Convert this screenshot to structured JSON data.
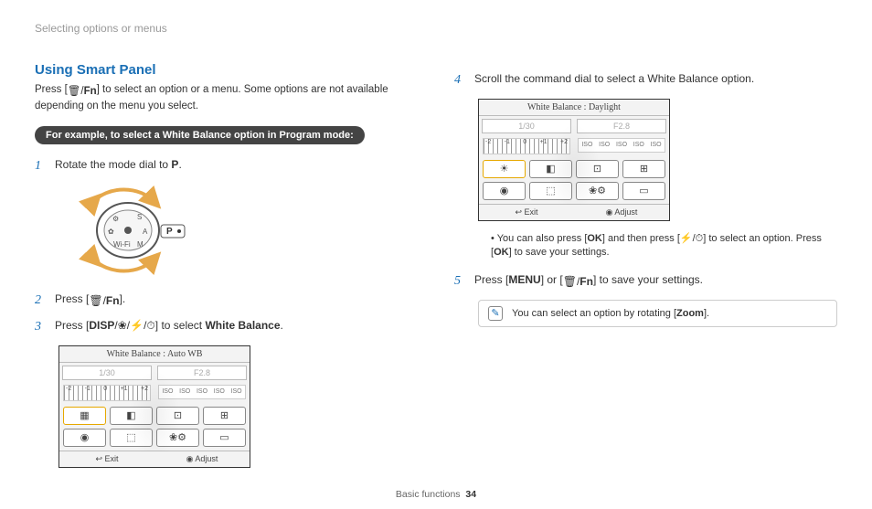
{
  "breadcrumb": "Selecting options or menus",
  "title": "Using Smart Panel",
  "intro_a": "Press [",
  "intro_b": "] to select an option or a menu. Some options are not available depending on the menu you select.",
  "pill": "For example, to select a White Balance option in Program mode:",
  "step1_a": "Rotate the mode dial to ",
  "step1_b": ".",
  "step2_a": "Press [",
  "step2_b": "].",
  "step3_a": "Press [",
  "step3_b": "] to select ",
  "step3_c": "White Balance",
  "step3_d": ".",
  "step4": "Scroll the command dial to select a White Balance option.",
  "bullet_a": "You can also press [",
  "bullet_b": "] and then press [",
  "bullet_c": "] to select an option. Press [",
  "bullet_d": "] to save your settings.",
  "step5_a": "Press [",
  "step5_b": "] or [",
  "step5_c": "] to save your settings.",
  "note_a": "You can select an option by rotating [",
  "note_b": "Zoom",
  "note_c": "].",
  "footer_section": "Basic functions",
  "footer_page": "34",
  "buttons": {
    "trash_fn": "🗑/Fn",
    "disp": "DISP",
    "macro": "❀",
    "flash": "⚡",
    "timer": "⏱",
    "ok": "OK",
    "menu": "MENU",
    "P": "P"
  },
  "panels": {
    "auto": {
      "title": "White Balance : Auto WB",
      "shutter": "1/30",
      "aperture": "F2.8",
      "ev_labels": [
        "-2",
        "-1",
        "0",
        "+1",
        "+2"
      ],
      "iso_labels": [
        "ISO",
        "ISO",
        "ISO",
        "ISO",
        "ISO"
      ],
      "icons": [
        "▦",
        "◧",
        "⊡",
        "⊞",
        "◉",
        "⬚",
        "❀⚙",
        "▭"
      ],
      "exit": "Exit",
      "adjust": "Adjust"
    },
    "daylight": {
      "title": "White Balance : Daylight",
      "shutter": "1/30",
      "aperture": "F2.8",
      "ev_labels": [
        "-2",
        "-1",
        "0",
        "+1",
        "+2"
      ],
      "iso_labels": [
        "ISO",
        "ISO",
        "ISO",
        "ISO",
        "ISO"
      ],
      "icons": [
        "☀",
        "◧",
        "⊡",
        "⊞",
        "◉",
        "⬚",
        "❀⚙",
        "▭"
      ],
      "exit": "Exit",
      "adjust": "Adjust"
    }
  }
}
